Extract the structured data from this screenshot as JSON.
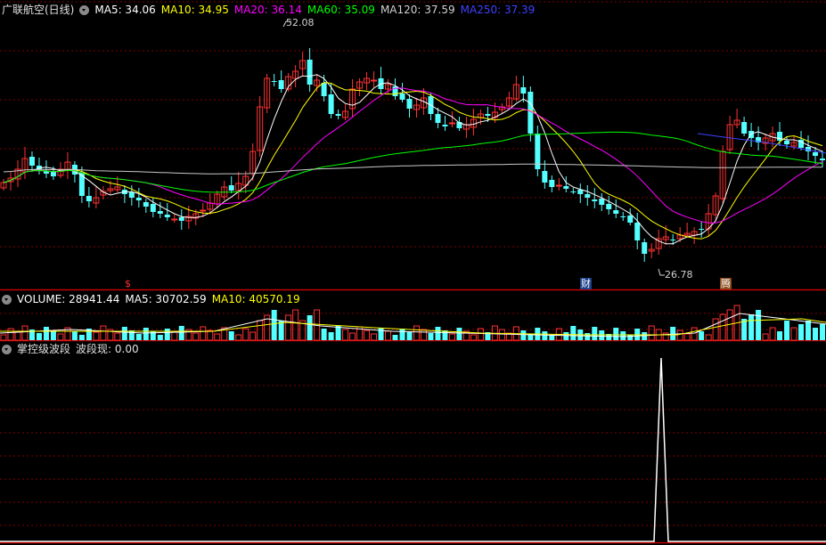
{
  "main_panel": {
    "title": "广联航空(日线)",
    "ma_labels": [
      {
        "name": "ma5",
        "text": "MA5: 34.06",
        "color": "#ffffff"
      },
      {
        "name": "ma10",
        "text": "MA10: 34.95",
        "color": "#ffff00"
      },
      {
        "name": "ma20",
        "text": "MA20: 36.14",
        "color": "#ff00ff"
      },
      {
        "name": "ma60",
        "text": "MA60: 35.09",
        "color": "#00ff00"
      },
      {
        "name": "ma120",
        "text": "MA120: 37.59",
        "color": "#d0d0d0"
      },
      {
        "name": "ma250",
        "text": "MA250: 37.39",
        "color": "#4040ff"
      }
    ],
    "high_label": "52.08",
    "low_label": "26.78",
    "markers": {
      "left": "$",
      "cai": "财",
      "teng": "腾"
    }
  },
  "volume_panel": {
    "labels": [
      {
        "name": "volume",
        "text": "VOLUME: 28941.44",
        "color": "#ffffff"
      },
      {
        "name": "vma5",
        "text": "MA5: 30702.59",
        "color": "#ffffff"
      },
      {
        "name": "vma10",
        "text": "MA10: 40570.19",
        "color": "#ffff00"
      }
    ]
  },
  "indicator_panel": {
    "name": "掌控级波段",
    "value_label": "波段现: 0.00"
  },
  "colors": {
    "up": "#ff3232",
    "down": "#54ffff",
    "grid": "#800000",
    "border": "#c00000"
  }
}
